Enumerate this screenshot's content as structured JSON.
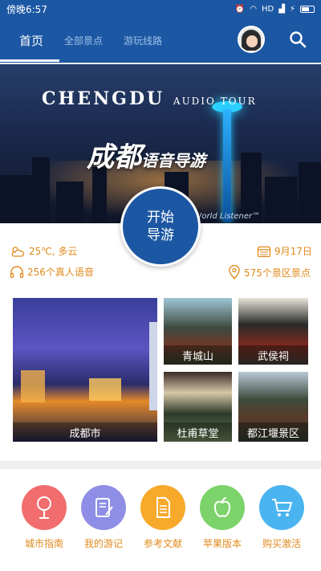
{
  "status_bar": {
    "time": "傍晚6:57",
    "network": "HD"
  },
  "tabs": [
    {
      "label": "首页",
      "active": true
    },
    {
      "label": "全部景点",
      "active": false
    },
    {
      "label": "游玩线路",
      "active": false
    }
  ],
  "banner": {
    "title_main": "CHENGDU",
    "title_sub": "AUDIO TOUR",
    "title_cn": "成都",
    "title_cn_sub": "语音导游",
    "credit": "by World Listener™"
  },
  "start_button": {
    "label": "开始导游"
  },
  "info": {
    "weather": "25℃, 多云",
    "date": "9月17日",
    "voices": "256个真人语音",
    "spots": "575个景区景点"
  },
  "tiles": [
    {
      "label": "成都市"
    },
    {
      "label": "青城山"
    },
    {
      "label": "武侯祠"
    },
    {
      "label": "杜甫草堂"
    },
    {
      "label": "都江堰景区"
    }
  ],
  "menu": [
    {
      "label": "城市指南",
      "color": "#f26d6d"
    },
    {
      "label": "我的游记",
      "color": "#8e8ee6"
    },
    {
      "label": "参考文献",
      "color": "#f7a92b"
    },
    {
      "label": "苹果版本",
      "color": "#7dd36b"
    },
    {
      "label": "购买激活",
      "color": "#4ab4f0"
    }
  ],
  "colors": {
    "primary": "#1c57a3",
    "accent": "#e08a1d"
  }
}
